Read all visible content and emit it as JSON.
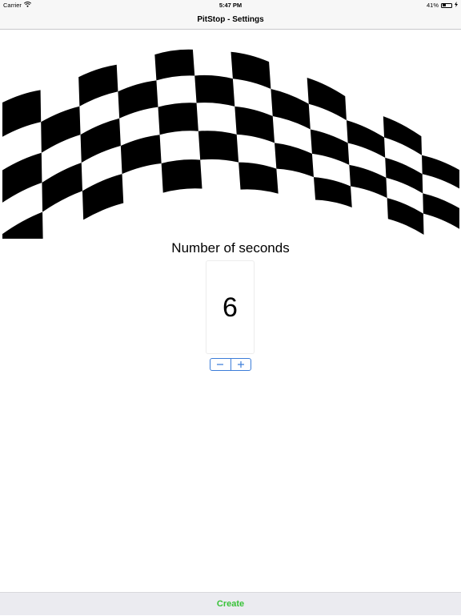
{
  "status_bar": {
    "carrier": "Carrier",
    "time": "5:47 PM",
    "battery_text": "41%",
    "battery_level": 0.41,
    "icons": [
      "wifi-icon",
      "battery-icon",
      "charging-icon"
    ]
  },
  "nav": {
    "title": "PitStop - Settings"
  },
  "settings": {
    "seconds_label": "Number of seconds",
    "seconds_value": "6",
    "stepper_decrement": "−",
    "stepper_increment": "+"
  },
  "footer": {
    "create_label": "Create"
  },
  "colors": {
    "accent": "#3c7dd9",
    "create": "#38c238",
    "flag_dark": "#000000",
    "bar_bg": "#f7f7f7",
    "bottom_bg": "#ebebf0"
  }
}
